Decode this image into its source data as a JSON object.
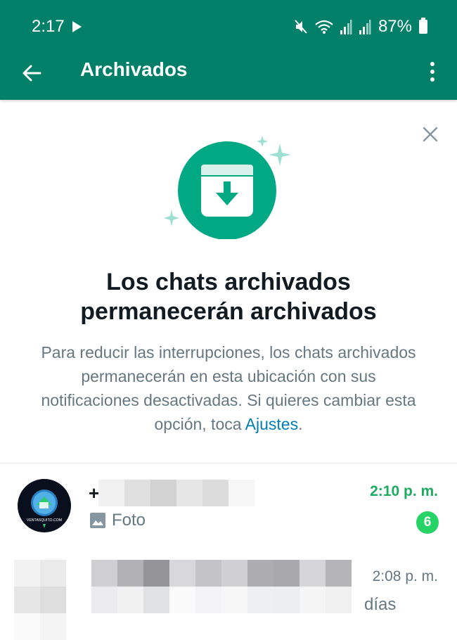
{
  "status_bar": {
    "time": "2:17",
    "battery": "87%",
    "icons": [
      "play-icon",
      "mute-icon",
      "wifi-icon",
      "signal-icon",
      "signal-icon",
      "battery-icon"
    ]
  },
  "app_bar": {
    "title": "Archivados",
    "back_icon": "arrow-left-icon",
    "menu_icon": "more-vert-icon"
  },
  "banner": {
    "close_icon": "close-icon",
    "illustration_icon": "archive-icon",
    "headline": "Los chats archivados permanecerán archivados",
    "description_text": "Para reducir las interrupciones, los chats archivados permanecerán en esta ubicación con sus notificaciones desactivadas. Si quieres cambiar esta opción, toca ",
    "description_link": "Ajustes",
    "description_end": "."
  },
  "chats": [
    {
      "name_prefix": "+",
      "time": "2:10 p. m.",
      "preview_icon": "image-icon",
      "preview": "Foto",
      "unread_count": "6",
      "avatar_text": "VENTASQUITO.COM"
    },
    {
      "time": "2:08 p. m.",
      "preview": "días"
    }
  ],
  "colors": {
    "header": "#008069",
    "accent": "#00a884",
    "unread_time": "#1daa61",
    "badge": "#25d366",
    "link": "#027eb5",
    "secondary_text": "#667781",
    "primary_text": "#111b21"
  }
}
